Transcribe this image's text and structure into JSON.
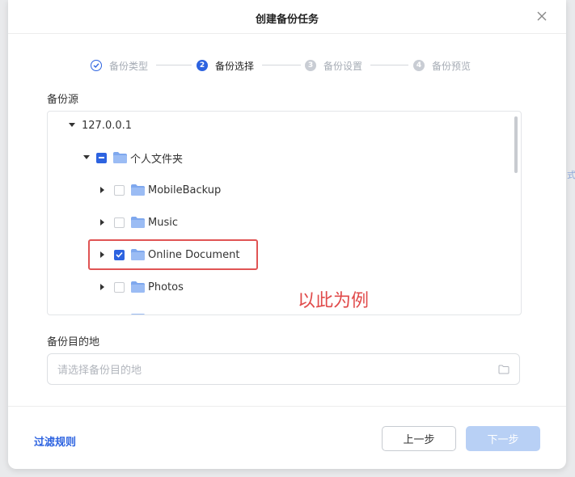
{
  "dialog": {
    "title": "创建备份任务"
  },
  "steps": [
    {
      "num": "✓",
      "label": "备份类型",
      "state": "done"
    },
    {
      "num": "2",
      "label": "备份选择",
      "state": "active"
    },
    {
      "num": "3",
      "label": "备份设置",
      "state": "todo"
    },
    {
      "num": "4",
      "label": "备份预览",
      "state": "todo"
    }
  ],
  "source": {
    "label": "备份源",
    "tree": {
      "root": "127.0.0.1",
      "personal_folder": "个人文件夹",
      "items": [
        {
          "name": "MobileBackup",
          "checked": false
        },
        {
          "name": "Music",
          "checked": false
        },
        {
          "name": "Online Document",
          "checked": true
        },
        {
          "name": "Photos",
          "checked": false
        }
      ]
    }
  },
  "annotation": "以此为例",
  "destination": {
    "label": "备份目的地",
    "placeholder": "请选择备份目的地"
  },
  "footer": {
    "filter_rules": "过滤规则",
    "prev": "上一步",
    "next": "下一步"
  },
  "edge_glyph": "式",
  "colors": {
    "accent": "#2d63e0",
    "highlight": "#e05454",
    "next_disabled": "#b8d0f5"
  }
}
